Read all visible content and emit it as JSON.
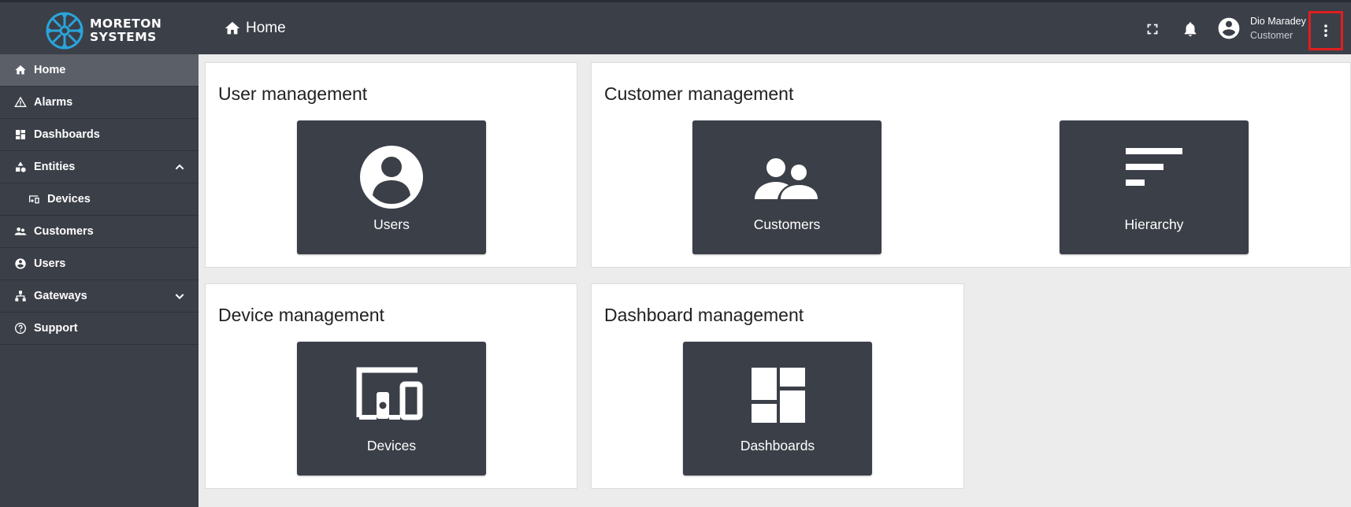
{
  "brand": {
    "line1": "MORETON",
    "line2": "SYSTEMS",
    "accent": "#2aa4db"
  },
  "header": {
    "breadcrumb": "Home",
    "user_name": "Dio Maradey",
    "user_role": "Customer"
  },
  "sidebar": {
    "items": [
      {
        "label": "Home",
        "icon": "home-icon"
      },
      {
        "label": "Alarms",
        "icon": "warning-icon"
      },
      {
        "label": "Dashboards",
        "icon": "dashboard-icon"
      },
      {
        "label": "Entities",
        "icon": "entities-icon"
      },
      {
        "label": "Devices",
        "icon": "devices-icon"
      },
      {
        "label": "Customers",
        "icon": "customers-icon"
      },
      {
        "label": "Users",
        "icon": "user-circle-icon"
      },
      {
        "label": "Gateways",
        "icon": "gateway-icon"
      },
      {
        "label": "Support",
        "icon": "help-icon"
      }
    ]
  },
  "cards": {
    "user_management": {
      "title": "User management",
      "tiles": [
        "Users"
      ]
    },
    "customer_management": {
      "title": "Customer management",
      "tiles": [
        "Customers",
        "Hierarchy"
      ]
    },
    "device_management": {
      "title": "Device management",
      "tiles": [
        "Devices"
      ]
    },
    "dashboard_management": {
      "title": "Dashboard management",
      "tiles": [
        "Dashboards"
      ]
    }
  },
  "colors": {
    "topbar": "#3b3f48",
    "tile": "#3b3f48",
    "active_nav": "#5b5f68",
    "highlight": "#e01e1e"
  }
}
